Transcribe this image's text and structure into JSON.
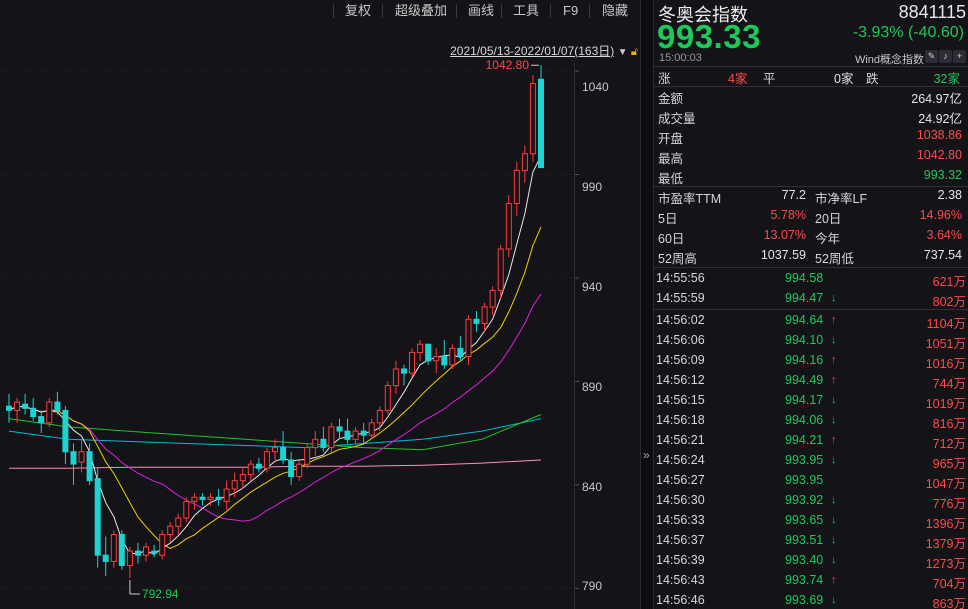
{
  "toolbar": {
    "items": [
      "复权",
      "超级叠加",
      "画线",
      "工具",
      "F9",
      "隐藏"
    ]
  },
  "range": {
    "text": "2021/05/13-2022/01/07(163日)"
  },
  "chart_data": {
    "type": "candlestick",
    "ylim": [
      780,
      1055
    ],
    "price_ticks": [
      "1040",
      "990",
      "940",
      "890",
      "840",
      "790"
    ],
    "high_label": "1042.80",
    "low_label": "792.94",
    "candles": [
      {
        "o": 878,
        "h": 884,
        "l": 870,
        "c": 876
      },
      {
        "o": 876,
        "h": 882,
        "l": 870,
        "c": 880
      },
      {
        "o": 879,
        "h": 884,
        "l": 874,
        "c": 877
      },
      {
        "o": 877,
        "h": 882,
        "l": 871,
        "c": 873
      },
      {
        "o": 873,
        "h": 876,
        "l": 865,
        "c": 870
      },
      {
        "o": 870,
        "h": 882,
        "l": 868,
        "c": 880
      },
      {
        "o": 880,
        "h": 885,
        "l": 874,
        "c": 876
      },
      {
        "o": 876,
        "h": 878,
        "l": 850,
        "c": 856
      },
      {
        "o": 856,
        "h": 860,
        "l": 840,
        "c": 850
      },
      {
        "o": 851,
        "h": 862,
        "l": 846,
        "c": 856
      },
      {
        "o": 856,
        "h": 860,
        "l": 840,
        "c": 842
      },
      {
        "o": 843,
        "h": 848,
        "l": 800,
        "c": 806
      },
      {
        "o": 806,
        "h": 815,
        "l": 796,
        "c": 803
      },
      {
        "o": 803,
        "h": 818,
        "l": 800,
        "c": 816
      },
      {
        "o": 816,
        "h": 818,
        "l": 799,
        "c": 801
      },
      {
        "o": 801,
        "h": 810,
        "l": 795,
        "c": 808
      },
      {
        "o": 808,
        "h": 812,
        "l": 802,
        "c": 806
      },
      {
        "o": 806,
        "h": 812,
        "l": 803,
        "c": 810
      },
      {
        "o": 808,
        "h": 811,
        "l": 805,
        "c": 807
      },
      {
        "o": 806,
        "h": 818,
        "l": 804,
        "c": 816
      },
      {
        "o": 816,
        "h": 822,
        "l": 812,
        "c": 820
      },
      {
        "o": 820,
        "h": 826,
        "l": 816,
        "c": 824
      },
      {
        "o": 824,
        "h": 834,
        "l": 822,
        "c": 832
      },
      {
        "o": 832,
        "h": 836,
        "l": 828,
        "c": 834
      },
      {
        "o": 834,
        "h": 836,
        "l": 830,
        "c": 833
      },
      {
        "o": 833,
        "h": 836,
        "l": 830,
        "c": 834
      },
      {
        "o": 834,
        "h": 838,
        "l": 830,
        "c": 833
      },
      {
        "o": 832,
        "h": 842,
        "l": 828,
        "c": 838
      },
      {
        "o": 838,
        "h": 846,
        "l": 834,
        "c": 842
      },
      {
        "o": 842,
        "h": 848,
        "l": 838,
        "c": 845
      },
      {
        "o": 845,
        "h": 852,
        "l": 842,
        "c": 850
      },
      {
        "o": 850,
        "h": 853,
        "l": 846,
        "c": 848
      },
      {
        "o": 848,
        "h": 858,
        "l": 846,
        "c": 856
      },
      {
        "o": 856,
        "h": 862,
        "l": 852,
        "c": 858
      },
      {
        "o": 858,
        "h": 866,
        "l": 850,
        "c": 852
      },
      {
        "o": 852,
        "h": 856,
        "l": 840,
        "c": 844
      },
      {
        "o": 844,
        "h": 852,
        "l": 842,
        "c": 850
      },
      {
        "o": 850,
        "h": 860,
        "l": 848,
        "c": 858
      },
      {
        "o": 858,
        "h": 866,
        "l": 854,
        "c": 862
      },
      {
        "o": 862,
        "h": 868,
        "l": 856,
        "c": 858
      },
      {
        "o": 858,
        "h": 870,
        "l": 856,
        "c": 868
      },
      {
        "o": 868,
        "h": 872,
        "l": 862,
        "c": 866
      },
      {
        "o": 866,
        "h": 872,
        "l": 860,
        "c": 862
      },
      {
        "o": 862,
        "h": 868,
        "l": 860,
        "c": 866
      },
      {
        "o": 866,
        "h": 870,
        "l": 860,
        "c": 864
      },
      {
        "o": 864,
        "h": 872,
        "l": 862,
        "c": 870
      },
      {
        "o": 870,
        "h": 878,
        "l": 866,
        "c": 876
      },
      {
        "o": 876,
        "h": 890,
        "l": 874,
        "c": 888
      },
      {
        "o": 888,
        "h": 900,
        "l": 884,
        "c": 896
      },
      {
        "o": 896,
        "h": 898,
        "l": 888,
        "c": 894
      },
      {
        "o": 894,
        "h": 906,
        "l": 892,
        "c": 904
      },
      {
        "o": 904,
        "h": 910,
        "l": 900,
        "c": 908
      },
      {
        "o": 908,
        "h": 908,
        "l": 898,
        "c": 900
      },
      {
        "o": 900,
        "h": 906,
        "l": 894,
        "c": 902
      },
      {
        "o": 902,
        "h": 910,
        "l": 896,
        "c": 898
      },
      {
        "o": 898,
        "h": 908,
        "l": 896,
        "c": 906
      },
      {
        "o": 906,
        "h": 912,
        "l": 900,
        "c": 902
      },
      {
        "o": 902,
        "h": 922,
        "l": 898,
        "c": 920
      },
      {
        "o": 920,
        "h": 924,
        "l": 914,
        "c": 918
      },
      {
        "o": 918,
        "h": 928,
        "l": 914,
        "c": 926
      },
      {
        "o": 926,
        "h": 936,
        "l": 922,
        "c": 934
      },
      {
        "o": 934,
        "h": 956,
        "l": 930,
        "c": 954
      },
      {
        "o": 954,
        "h": 980,
        "l": 950,
        "c": 976
      },
      {
        "o": 976,
        "h": 996,
        "l": 970,
        "c": 992
      },
      {
        "o": 992,
        "h": 1004,
        "l": 986,
        "c": 1000
      },
      {
        "o": 1000,
        "h": 1038,
        "l": 996,
        "c": 1034
      },
      {
        "o": 1036,
        "h": 1042.8,
        "l": 993.32,
        "c": 993.33
      }
    ]
  },
  "quote": {
    "name": "冬奥会指数",
    "code": "8841115",
    "price": "993.33",
    "change": "-3.93% (-40.60)",
    "time": "15:00:03",
    "source": "Wind概念指数",
    "breadth": {
      "up_label": "涨",
      "up": "4家",
      "flat_label": "平",
      "flat": "0家",
      "down_label": "跌",
      "down": "32家"
    },
    "stats": [
      {
        "label": "金额",
        "value": "264.97亿",
        "color": "white"
      },
      {
        "label": "成交量",
        "value": "24.92亿",
        "color": "white"
      },
      {
        "label": "开盘",
        "value": "1038.86",
        "color": "red"
      },
      {
        "label": "最高",
        "value": "1042.80",
        "color": "red"
      },
      {
        "label": "最低",
        "value": "993.32",
        "color": "green"
      }
    ],
    "ratios": [
      {
        "l1": "市盈率TTM",
        "v1": "77.2",
        "c1": "white",
        "l2": "市净率LF",
        "v2": "2.38",
        "c2": "white"
      },
      {
        "l1": "5日",
        "v1": "5.78%",
        "c1": "red",
        "l2": "20日",
        "v2": "14.96%",
        "c2": "red"
      },
      {
        "l1": "60日",
        "v1": "13.07%",
        "c1": "red",
        "l2": "今年",
        "v2": "3.64%",
        "c2": "red"
      },
      {
        "l1": "52周高",
        "v1": "1037.59",
        "c1": "white",
        "l2": "52周低",
        "v2": "737.54",
        "c2": "white"
      }
    ],
    "ticks": [
      {
        "time": "14:55:56",
        "price": "994.58",
        "arrow": "",
        "vol": "621万"
      },
      {
        "time": "14:55:59",
        "price": "994.47",
        "arrow": "down",
        "vol": "802万"
      },
      {
        "time": "14:56:02",
        "price": "994.64",
        "arrow": "up",
        "vol": "1104万"
      },
      {
        "time": "14:56:06",
        "price": "994.10",
        "arrow": "down",
        "vol": "1051万"
      },
      {
        "time": "14:56:09",
        "price": "994.16",
        "arrow": "up",
        "vol": "1016万"
      },
      {
        "time": "14:56:12",
        "price": "994.49",
        "arrow": "up",
        "vol": "744万"
      },
      {
        "time": "14:56:15",
        "price": "994.17",
        "arrow": "down",
        "vol": "1019万"
      },
      {
        "time": "14:56:18",
        "price": "994.06",
        "arrow": "down",
        "vol": "816万"
      },
      {
        "time": "14:56:21",
        "price": "994.21",
        "arrow": "up",
        "vol": "712万"
      },
      {
        "time": "14:56:24",
        "price": "993.95",
        "arrow": "down",
        "vol": "965万"
      },
      {
        "time": "14:56:27",
        "price": "993.95",
        "arrow": "",
        "vol": "1047万"
      },
      {
        "time": "14:56:30",
        "price": "993.92",
        "arrow": "down",
        "vol": "776万"
      },
      {
        "time": "14:56:33",
        "price": "993.65",
        "arrow": "down",
        "vol": "1396万"
      },
      {
        "time": "14:56:37",
        "price": "993.51",
        "arrow": "down",
        "vol": "1379万"
      },
      {
        "time": "14:56:39",
        "price": "993.40",
        "arrow": "down",
        "vol": "1273万"
      },
      {
        "time": "14:56:43",
        "price": "993.74",
        "arrow": "up",
        "vol": "704万"
      },
      {
        "time": "14:56:46",
        "price": "993.69",
        "arrow": "down",
        "vol": "863万"
      }
    ]
  },
  "colors": {
    "up": "#ff3b3b",
    "down": "#1fd3d3",
    "quote_green": "#1fc85a",
    "ma5": "#e8e8e8",
    "ma10": "#f0d000",
    "ma20": "#e020e0",
    "ma60": "#22c322",
    "ma120": "#00b8d4",
    "ma250": "#ff8fb0"
  }
}
